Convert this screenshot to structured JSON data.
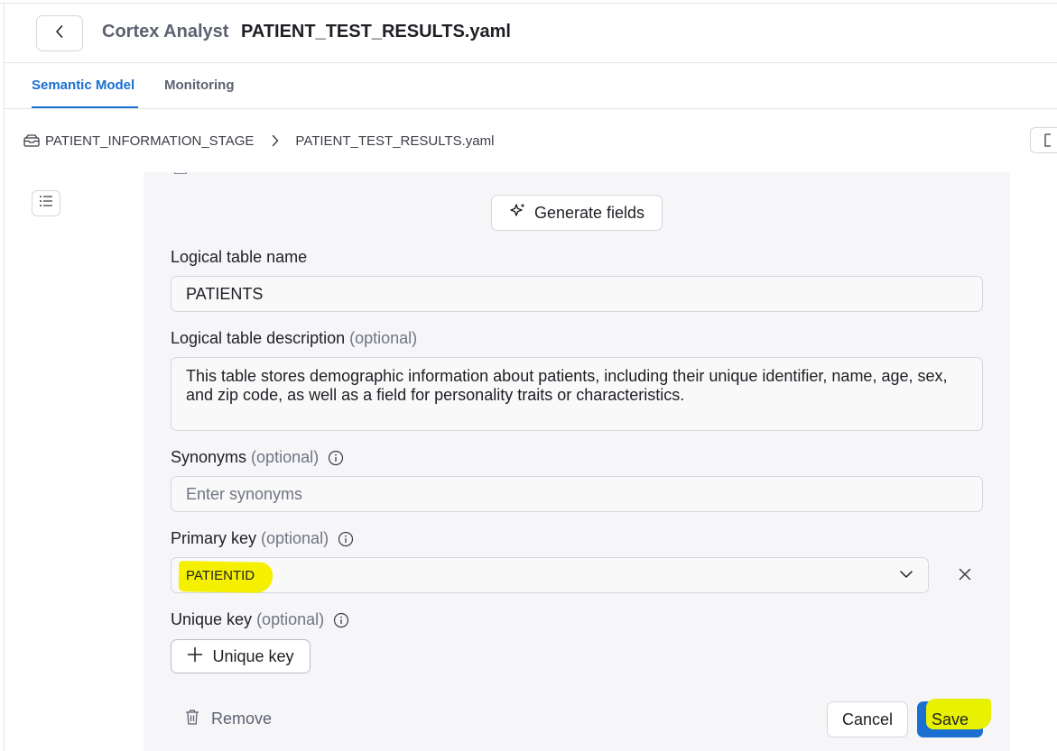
{
  "header": {
    "app_name": "Cortex Analyst",
    "file_title": "PATIENT_TEST_RESULTS.yaml"
  },
  "tabs": [
    {
      "label": "Semantic Model",
      "active": true
    },
    {
      "label": "Monitoring",
      "active": false
    }
  ],
  "breadcrumb": {
    "stage": "PATIENT_INFORMATION_STAGE",
    "file": "PATIENT_TEST_RESULTS.yaml"
  },
  "form": {
    "generate_label": "Generate fields",
    "table_name_label": "Logical table name",
    "table_name_value": "PATIENTS",
    "description_label": "Logical table description",
    "description_value": "This table stores demographic information about patients, including their unique identifier, name, age, sex, and zip code, as well as a field for personality traits or characteristics.",
    "synonyms_label": "Synonyms",
    "synonyms_placeholder": "Enter synonyms",
    "primary_key_label": "Primary key",
    "primary_key_value": "PATIENTID",
    "unique_key_label": "Unique key",
    "unique_key_button": "Unique key",
    "optional": "(optional)"
  },
  "actions": {
    "remove": "Remove",
    "cancel": "Cancel",
    "save": "Save"
  },
  "colors": {
    "accent": "#1a6fd1",
    "highlight": "#f4f000"
  },
  "icons": [
    "chevron-left-icon",
    "stage-icon",
    "chevron-right-icon",
    "outline-list-icon",
    "sparkle-icon",
    "info-icon",
    "chevron-down-icon",
    "close-icon",
    "plus-icon",
    "trash-icon"
  ]
}
